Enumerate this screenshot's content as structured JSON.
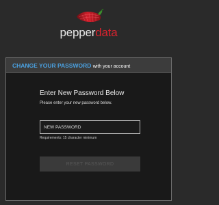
{
  "brand": {
    "name_part1": "pepper",
    "name_part2": "data",
    "icon": "pepper-logo-icon",
    "colors": {
      "accent_red": "#d9232e",
      "accent_blue": "#4aa0e0"
    }
  },
  "card": {
    "title_accent": "CHANGE YOUR PASSWORD",
    "title_rest": "with your account"
  },
  "form": {
    "heading": "Enter New Password Below",
    "subheading": "Please enter your new password below.",
    "password_placeholder": "NEW PASSWORD",
    "requirements": "Requirements: 15 character minimum",
    "submit_label": "RESET PASSWORD"
  }
}
